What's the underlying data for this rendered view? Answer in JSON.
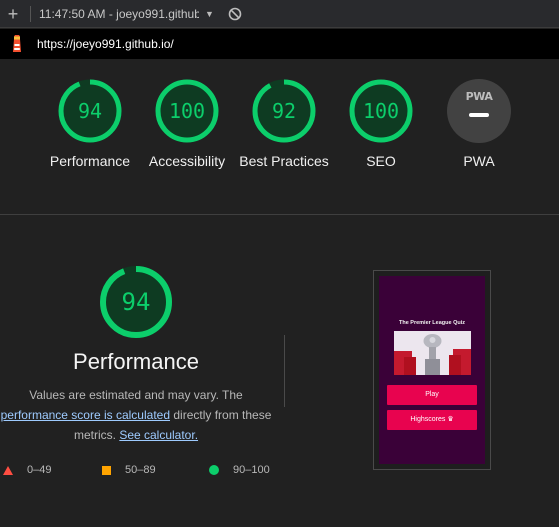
{
  "toolbar": {
    "plus": "+",
    "run_label": "11:47:50 AM - joeyo991.github",
    "caret": "▼"
  },
  "urlbar": {
    "url": "https://joeyo991.github.io/"
  },
  "gauges": [
    {
      "label": "Performance",
      "score": "94",
      "value": 94
    },
    {
      "label": "Accessibility",
      "score": "100",
      "value": 100
    },
    {
      "label": "Best Practices",
      "score": "92",
      "value": 92
    },
    {
      "label": "SEO",
      "score": "100",
      "value": 100
    },
    {
      "label": "PWA",
      "badge": "PWA"
    }
  ],
  "performance": {
    "score": "94",
    "value": 94,
    "title": "Performance",
    "desc_prefix": "Values are estimated and may vary. The",
    "desc_link1": "performance score is calculated",
    "desc_mid": "directly from these",
    "desc_suffix": "metrics.",
    "desc_link2": "See calculator."
  },
  "legend": [
    {
      "range": "0–49",
      "color": "#ff4e42"
    },
    {
      "range": "50–89",
      "color": "#ffa400"
    },
    {
      "range": "90–100",
      "color": "#0cce6b"
    }
  ],
  "thumbnail": {
    "title": "The Premier League Quiz",
    "play_label": "Play",
    "highscores_label": "Highscores ♛"
  },
  "colors": {
    "pass": "#0cce6b",
    "pass_bg": "#0e3b22",
    "accent_link": "#9ecbff"
  }
}
